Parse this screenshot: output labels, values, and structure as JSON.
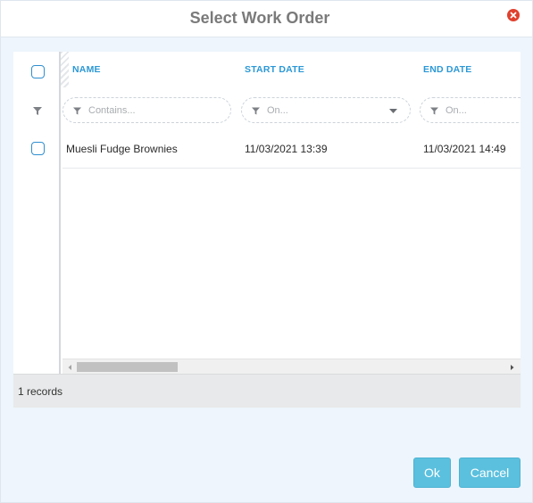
{
  "dialog": {
    "title": "Select Work Order"
  },
  "grid": {
    "columns": [
      "NAME",
      "START DATE",
      "END DATE"
    ],
    "filters": {
      "name": "Contains...",
      "start": "On...",
      "end": "On..."
    },
    "rows": [
      {
        "name": "Muesli Fudge Brownies",
        "start": "11/03/2021 13:39",
        "end": "11/03/2021 14:49"
      }
    ],
    "record_count": "1 records"
  },
  "buttons": {
    "ok": "Ok",
    "cancel": "Cancel"
  },
  "colors": {
    "accent": "#2b98d6",
    "button": "#5bc0de",
    "close": "#e0412e"
  }
}
